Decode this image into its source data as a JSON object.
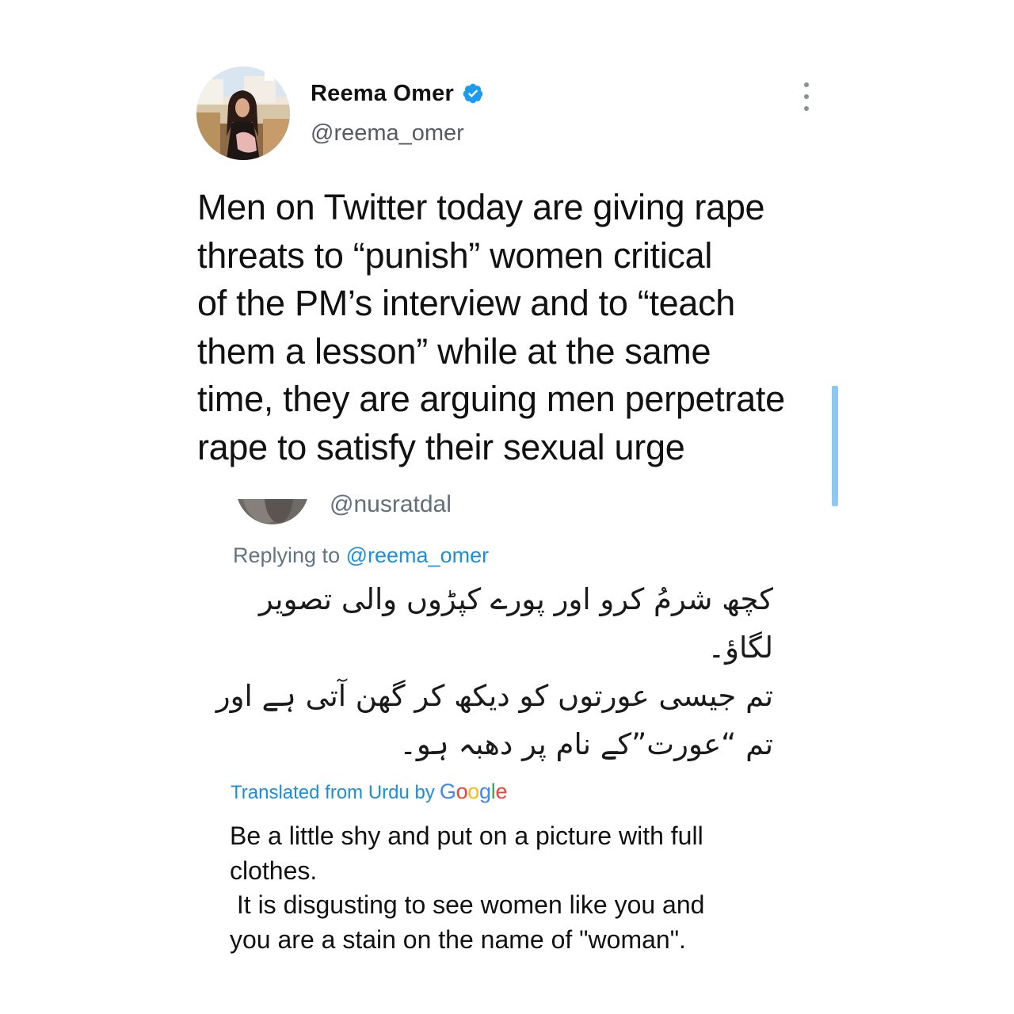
{
  "tweet": {
    "author": {
      "display_name": "Reema Omer",
      "handle": "@reema_omer",
      "verified": true,
      "avatar_icon": "profile-photo",
      "verified_icon": "verified-badge-icon"
    },
    "more_icon": "more-vertical-icon",
    "text_lines": [
      "Men on Twitter today are giving rape",
      "threats to “punish” women critical",
      "of the PM’s interview and to “teach",
      "them a lesson” while at the same",
      "time, they are arguing men perpetrate",
      "rape to satisfy their sexual urge"
    ]
  },
  "reply": {
    "handle_fragment": "@nusratdal",
    "replying_to_prefix": "Replying to",
    "replying_to_handle": "@reema_omer",
    "urdu_lines": [
      "کچھ شرمُ کرو اور پورے کپڑوں والی تصویر",
      "لگاؤ۔",
      "تم جیسی عورتوں کو دیکھ کر گھن آتی ہے اور",
      "تم “عورت”کے نام پر دھبہ ہو۔"
    ],
    "translated_from": "Translated from Urdu by",
    "google_letters": [
      "G",
      "o",
      "o",
      "g",
      "l",
      "e"
    ],
    "translation_lines": [
      "Be a little shy and put on a picture with full",
      "clothes.",
      " It is disgusting to see women like you and",
      "you are a stain on the name of \"woman\"."
    ]
  },
  "colors": {
    "accent": "#1d9bf0",
    "scroll_indicator": "#8ec8f0",
    "google": [
      "#4285F4",
      "#EA4335",
      "#FBBC05",
      "#4285F4",
      "#34A853",
      "#EA4335"
    ]
  }
}
